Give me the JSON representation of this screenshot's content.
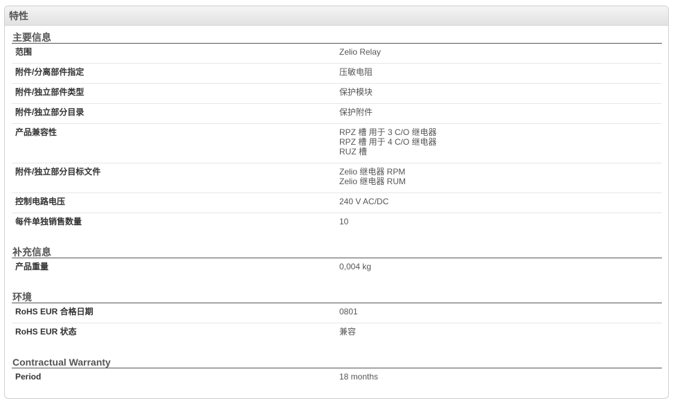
{
  "panel": {
    "title": "特性"
  },
  "sections": [
    {
      "title": "主要信息",
      "rows": [
        {
          "label": "范围",
          "values": [
            "Zelio Relay"
          ]
        },
        {
          "label": "附件/分离部件指定",
          "values": [
            "压敏电阻"
          ]
        },
        {
          "label": "附件/独立部件类型",
          "values": [
            "保护模块"
          ]
        },
        {
          "label": "附件/独立部分目录",
          "values": [
            "保护附件"
          ]
        },
        {
          "label": "产品兼容性",
          "values": [
            "RPZ 槽 用于 3 C/O 继电器",
            "RPZ 槽 用于 4 C/O 继电器",
            "RUZ 槽"
          ]
        },
        {
          "label": "附件/独立部分目标文件",
          "values": [
            "Zelio 继电器 RPM",
            "Zelio 继电器 RUM"
          ]
        },
        {
          "label": "控制电路电压",
          "values": [
            "240 V AC/DC"
          ]
        },
        {
          "label": "每件单独销售数量",
          "values": [
            "10"
          ]
        }
      ]
    },
    {
      "title": "补充信息",
      "rows": [
        {
          "label": "产品重量",
          "values": [
            "0,004 kg"
          ]
        }
      ]
    },
    {
      "title": "环境",
      "rows": [
        {
          "label": "RoHS EUR 合格日期",
          "values": [
            "0801"
          ]
        },
        {
          "label": "RoHS EUR 状态",
          "values": [
            "兼容"
          ]
        }
      ]
    },
    {
      "title": "Contractual Warranty",
      "rows": [
        {
          "label": "Period",
          "values": [
            "18 months"
          ]
        }
      ]
    }
  ]
}
